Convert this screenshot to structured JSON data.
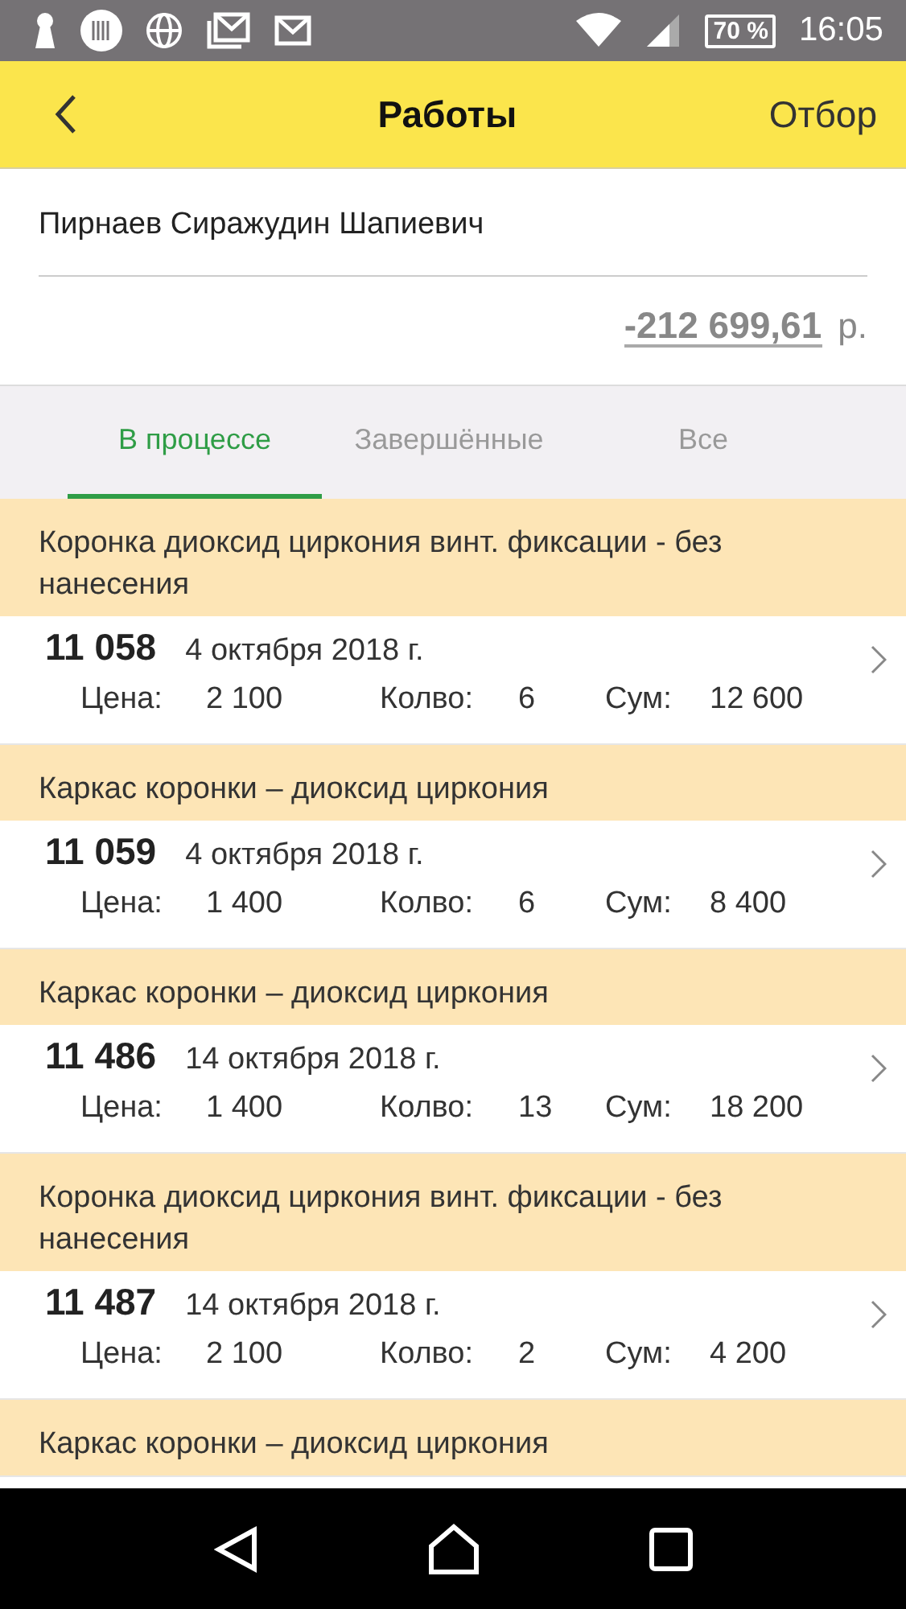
{
  "status_bar": {
    "battery": "70 %",
    "time": "16:05"
  },
  "header": {
    "title": "Работы",
    "action": "Отбор"
  },
  "client": {
    "name": "Пирнаев Сиражудин Шапиевич",
    "balance": "-212 699,61",
    "currency": "р."
  },
  "tabs": [
    {
      "label": "В процессе",
      "selected": true
    },
    {
      "label": "Завершённые",
      "selected": false
    },
    {
      "label": "Все",
      "selected": false
    }
  ],
  "items": [
    {
      "title": "Коронка диоксид циркония винт. фиксации - без нанесения",
      "number": "11 058",
      "date": "4 октября 2018 г.",
      "price_label": "Цена:",
      "price": "2 100",
      "qty_label": "Колво:",
      "qty": "6",
      "sum_label": "Сум:",
      "sum": "12 600"
    },
    {
      "title": "Каркас коронки – диоксид циркония",
      "number": "11 059",
      "date": "4 октября 2018 г.",
      "price_label": "Цена:",
      "price": "1 400",
      "qty_label": "Колво:",
      "qty": "6",
      "sum_label": "Сум:",
      "sum": "8 400"
    },
    {
      "title": "Каркас коронки – диоксид циркония",
      "number": "11 486",
      "date": "14 октября 2018 г.",
      "price_label": "Цена:",
      "price": "1 400",
      "qty_label": "Колво:",
      "qty": "13",
      "sum_label": "Сум:",
      "sum": "18 200"
    },
    {
      "title": "Коронка диоксид циркония винт. фиксации - без нанесения",
      "number": "11 487",
      "date": "14 октября 2018 г.",
      "price_label": "Цена:",
      "price": "2 100",
      "qty_label": "Колво:",
      "qty": "2",
      "sum_label": "Сум:",
      "sum": "4 200"
    },
    {
      "title": "Каркас коронки – диоксид циркония"
    }
  ]
}
